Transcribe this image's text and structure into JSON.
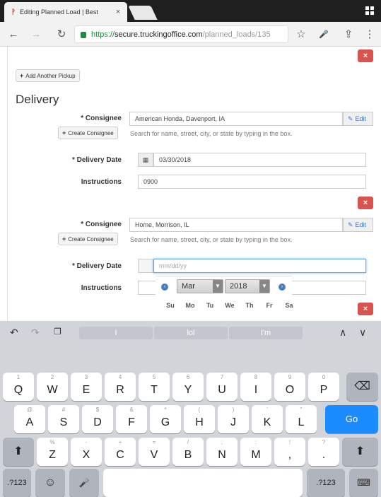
{
  "browser": {
    "tab_title": "Editing Planned Load | Best",
    "tab_close": "×",
    "url_scheme": "https://",
    "url_host": "secure.truckingoffice.com",
    "url_path": "/planned_loads/135"
  },
  "icons": {
    "back": "←",
    "forward": "→",
    "reload": "↻",
    "star": "☆",
    "mic": "🎤",
    "share": "⇪",
    "menu": "⋮",
    "delete": "×",
    "calendar": "▦",
    "edit": "✎",
    "plus": "+"
  },
  "pickup": {
    "add_another_label": "Add Another Pickup"
  },
  "delivery": {
    "heading": "Delivery",
    "create_consignee_label": "Create Consignee",
    "edit_label": "Edit",
    "search_help": "Search for name, street, city, or state by typing in the box.",
    "stop1": {
      "consignee_label": "* Consignee",
      "consignee_value": "American Honda, Davenport, IA",
      "date_label": "* Delivery Date",
      "date_value": "03/30/2018",
      "instructions_label": "Instructions",
      "instructions_value": "0900"
    },
    "stop2": {
      "consignee_label": "* Consignee",
      "consignee_value": "Home, Morrison, IL",
      "date_label": "* Delivery Date",
      "date_placeholder": "mm/dd/yy",
      "instructions_label": "Instructions"
    }
  },
  "datepicker": {
    "month": "Mar",
    "year": "2018",
    "weekdays": [
      "Su",
      "Mo",
      "Tu",
      "We",
      "Th",
      "Fr",
      "Sa"
    ]
  },
  "keyboard": {
    "suggestions": [
      "I",
      "lol",
      "I'm"
    ],
    "row1": [
      [
        "1",
        "Q"
      ],
      [
        "2",
        "W"
      ],
      [
        "3",
        "E"
      ],
      [
        "4",
        "R"
      ],
      [
        "5",
        "T"
      ],
      [
        "6",
        "Y"
      ],
      [
        "7",
        "U"
      ],
      [
        "8",
        "I"
      ],
      [
        "9",
        "O"
      ],
      [
        "0",
        "P"
      ]
    ],
    "row2": [
      [
        "@",
        "A"
      ],
      [
        "#",
        "S"
      ],
      [
        "$",
        "D"
      ],
      [
        "&",
        "F"
      ],
      [
        "*",
        "G"
      ],
      [
        "(",
        "H"
      ],
      [
        ")",
        "J"
      ],
      [
        "'",
        "K"
      ],
      [
        "\"",
        "L"
      ]
    ],
    "row3": [
      [
        "%",
        "Z"
      ],
      [
        "-",
        "X"
      ],
      [
        "+",
        "C"
      ],
      [
        "=",
        "V"
      ],
      [
        "/",
        "B"
      ],
      [
        ";",
        "N"
      ],
      [
        ":",
        "M"
      ],
      [
        "!",
        ","
      ],
      [
        "?",
        "."
      ]
    ],
    "go_label": "Go",
    "num_label": ".?123",
    "shift": "⬆",
    "backspace": "⌫"
  }
}
